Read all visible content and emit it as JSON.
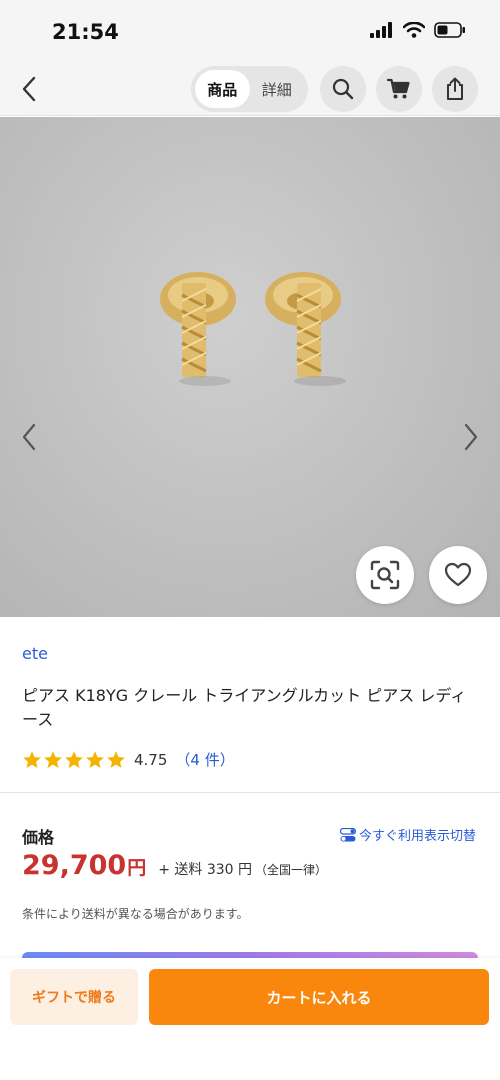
{
  "status_bar": {
    "time": "21:54"
  },
  "nav": {
    "tabs": [
      {
        "label": "商品",
        "active": true
      },
      {
        "label": "詳細",
        "active": false
      }
    ]
  },
  "icons": {
    "back": "chevron-left-icon",
    "search": "search-icon",
    "cart": "cart-icon",
    "share": "share-icon",
    "image_search": "image-search-icon",
    "favorite": "heart-icon",
    "prev_image": "chevron-left-icon",
    "next_image": "chevron-right-icon"
  },
  "product": {
    "shop_name": "ete",
    "title": "ピアス K18YG クレール トライアングルカット ピアス レディース",
    "rating": {
      "stars": 5,
      "score": "4.75",
      "count": "（4 件）"
    }
  },
  "price": {
    "label": "価格",
    "toggle_link": "今すぐ利用表示切替",
    "amount": "29,700",
    "currency": "円",
    "shipping": "+ 送料 330 円",
    "shipping_note": "（全国一律）",
    "note": "条件により送料が異なる場合があります。"
  },
  "actions": {
    "gift": "ギフトで贈る",
    "add_to_cart": "カートに入れる"
  },
  "colors": {
    "accent": "#f9860d",
    "price": "#c8322f",
    "link": "#2a5bd7",
    "star": "#f5b301"
  }
}
